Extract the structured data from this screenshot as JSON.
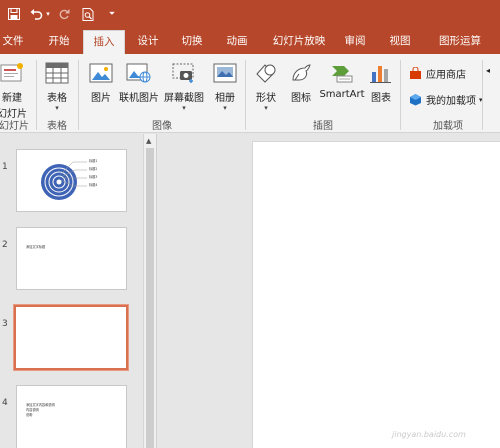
{
  "quick_access": {
    "save": "save-icon",
    "undo": "undo-icon",
    "redo": "redo-icon",
    "preview": "print-preview-icon",
    "customize": "customize-qat-icon"
  },
  "tabs": [
    {
      "label": "文件"
    },
    {
      "label": "开始"
    },
    {
      "label": "插入"
    },
    {
      "label": "设计"
    },
    {
      "label": "切换"
    },
    {
      "label": "动画"
    },
    {
      "label": "幻灯片放映"
    },
    {
      "label": "审阅"
    },
    {
      "label": "视图"
    },
    {
      "label": "图形运算"
    }
  ],
  "ribbon": {
    "new_slide": {
      "line1": "新建",
      "line2": "幻灯片"
    },
    "table": {
      "label": "表格"
    },
    "picture": {
      "label": "图片"
    },
    "online_picture": {
      "label": "联机图片"
    },
    "screenshot": {
      "label": "屏幕截图"
    },
    "album": {
      "label": "相册"
    },
    "shapes": {
      "label": "形状"
    },
    "icons": {
      "label": "图标"
    },
    "smartart": {
      "label": "SmartArt"
    },
    "chart": {
      "label": "图表"
    },
    "app_store": {
      "label": "应用商店"
    },
    "my_addins": {
      "label": "我的加载项"
    },
    "groups": {
      "slides": "幻灯片",
      "tables": "表格",
      "images": "图像",
      "illustrations": "插图",
      "addins": "加载项"
    }
  },
  "slides": [
    {
      "number": "1",
      "labels": [
        "标题1",
        "标题2",
        "标题3",
        "标题4"
      ]
    },
    {
      "number": "2",
      "text": "添加文字标题"
    },
    {
      "number": "3"
    },
    {
      "number": "4",
      "lines": [
        "添加文字内容和说明",
        "内容说明",
        "说明"
      ]
    }
  ],
  "colors": {
    "accent": "#b7472a",
    "ribbon_bg": "#f3f3f3",
    "selected_border": "#d7714f",
    "target_blue": "#3f63b5"
  },
  "watermark": "jingyan.baidu.com"
}
